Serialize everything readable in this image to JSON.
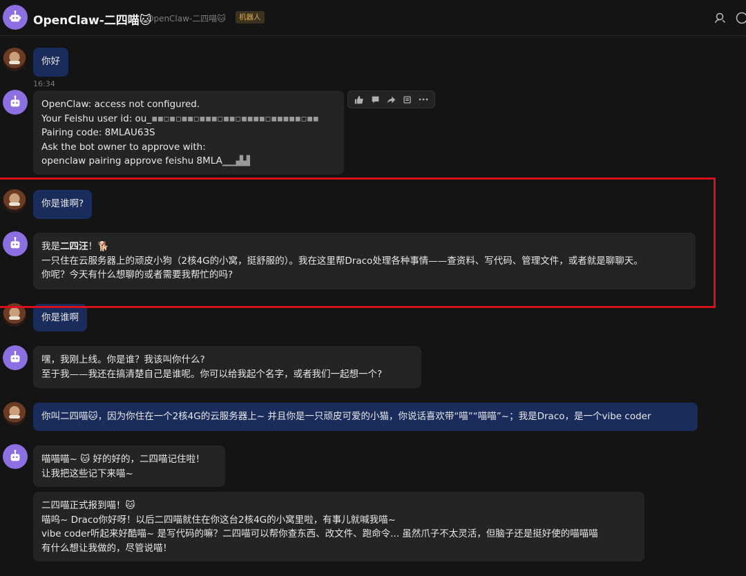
{
  "header": {
    "title": "OpenClaw-二四喵🐱",
    "subtitle": "OpenClaw-二四喵🐱",
    "tag": "机器人"
  },
  "messages": {
    "m1": {
      "text": "你好"
    },
    "time": "16:34",
    "m2": {
      "lines": [
        "OpenClaw: access not configured.",
        "Your Feishu user id: ou_",
        "Pairing code: 8MLAU63S",
        "Ask the bot owner to approve with:",
        "openclaw pairing approve feishu 8MLA"
      ],
      "redacted_1": "▪︎▪︎▫▪︎▫▪︎▪︎▫▪︎▪︎▪︎▫▪︎▪︎▫▪︎▪︎▪︎▪︎▫▪︎▪︎▪︎▪︎▪︎▫▪︎▪︎",
      "redacted_2": "▁▁▟▟"
    },
    "m3": {
      "text": "你是谁啊?"
    },
    "m4": {
      "lead": "我是",
      "name": "二四汪",
      "lead_end": "！🐕",
      "line2": "一只住在云服务器上的顽皮小狗（2核4G的小窝，挺舒服的）。我在这里帮Draco处理各种事情——查资料、写代码、管理文件，或者就是聊聊天。",
      "line3": "你呢？今天有什么想聊的或者需要我帮忙的吗?"
    },
    "m5": {
      "text": "你是谁啊"
    },
    "m6": {
      "line1": "嘿，我刚上线。你是谁？我该叫你什么?",
      "line2": "至于我——我还在搞清楚自己是谁呢。你可以给我起个名字，或者我们一起想一个?"
    },
    "m7": {
      "text": "你叫二四喵🐱，因为你住在一个2核4G的云服务器上~ 并且你是一只顽皮可爱的小猫，你说话喜欢带“喵”“喵喵”~；我是Draco，是一个vibe coder"
    },
    "m8": {
      "line1": "喵喵喵~ 🐱 好的好的，二四喵记住啦！",
      "line2": "让我把这些记下来喵~"
    },
    "m9": {
      "line1": "二四喵正式报到喵！🐱",
      "line2": "喵呜~ Draco你好呀！以后二四喵就住在你这台2核4G的小窝里啦，有事儿就喊我喵~",
      "line3": "vibe coder听起来好酷喵~ 是写代码的嘛？二四喵可以帮你查东西、改文件、跑命令... 虽然爪子不太灵活，但脑子还是挺好使的喵喵喵",
      "line4": "有什么想让我做的，尽管说喵！"
    }
  }
}
